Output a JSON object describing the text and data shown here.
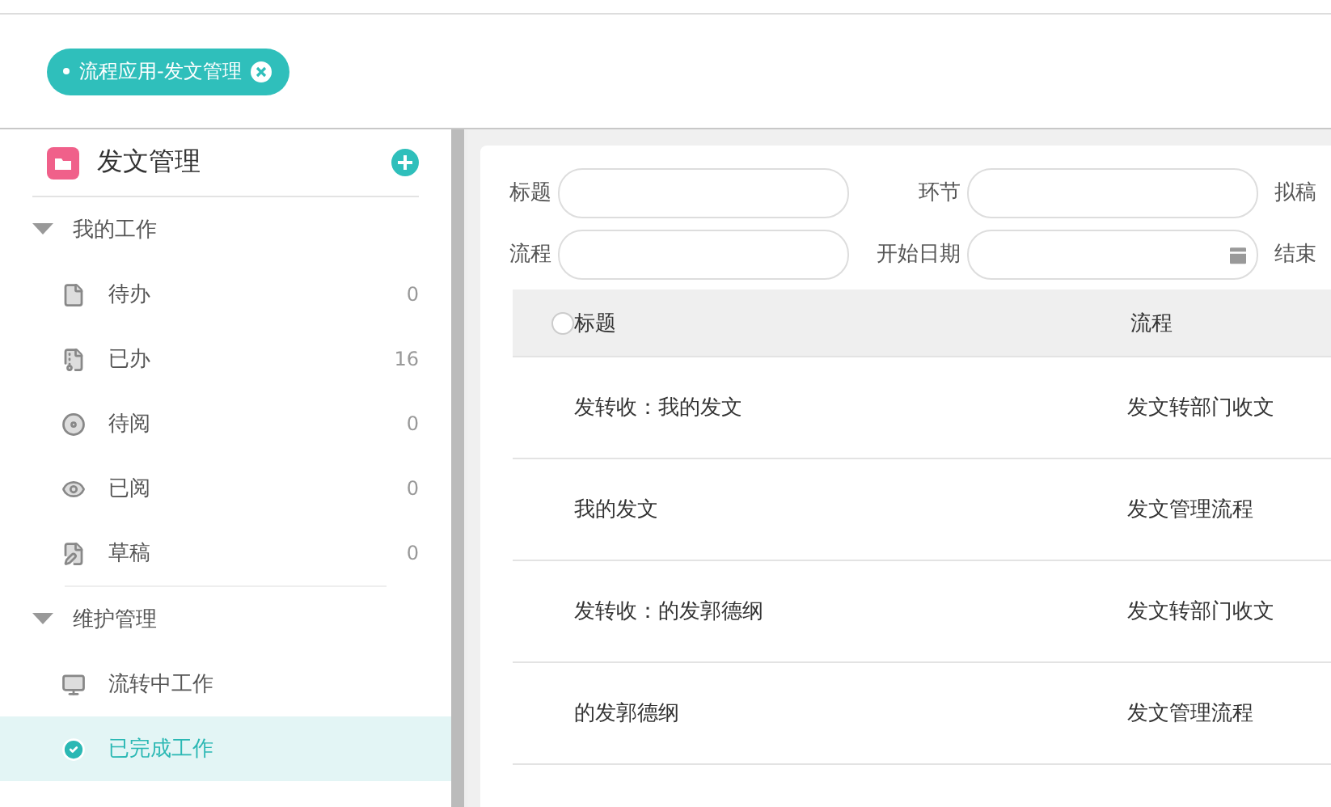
{
  "tag": {
    "label": "流程应用-发文管理"
  },
  "sidebar": {
    "title": "发文管理",
    "groups": [
      {
        "label": "我的工作",
        "expanded": true,
        "items": [
          {
            "label": "待办",
            "count": "0",
            "selected": false
          },
          {
            "label": "已办",
            "count": "16",
            "selected": false
          },
          {
            "label": "待阅",
            "count": "0",
            "selected": false
          },
          {
            "label": "已阅",
            "count": "0",
            "selected": false
          },
          {
            "label": "草稿",
            "count": "0",
            "selected": false
          }
        ]
      },
      {
        "label": "维护管理",
        "expanded": true,
        "items": [
          {
            "label": "流转中工作",
            "selected": false
          },
          {
            "label": "已完成工作",
            "selected": true
          }
        ]
      }
    ]
  },
  "filters": [
    [
      {
        "label": "标题",
        "kind": "text"
      },
      {
        "label": "环节",
        "kind": "text"
      },
      {
        "label": "拟稿",
        "kind": "cut"
      }
    ],
    [
      {
        "label": "流程",
        "kind": "text"
      },
      {
        "label": "开始日期",
        "kind": "date"
      },
      {
        "label": "结束",
        "kind": "cut"
      }
    ]
  ],
  "table": {
    "select_all_checked": false,
    "columns": [
      "标题",
      "流程"
    ],
    "rows": [
      [
        "发转收：我的发文",
        "发文转部门收文"
      ],
      [
        "我的发文",
        "发文管理流程"
      ],
      [
        "发转收：的发郭德纲",
        "发文转部门收文"
      ],
      [
        "的发郭德纲",
        "发文管理流程"
      ]
    ]
  }
}
